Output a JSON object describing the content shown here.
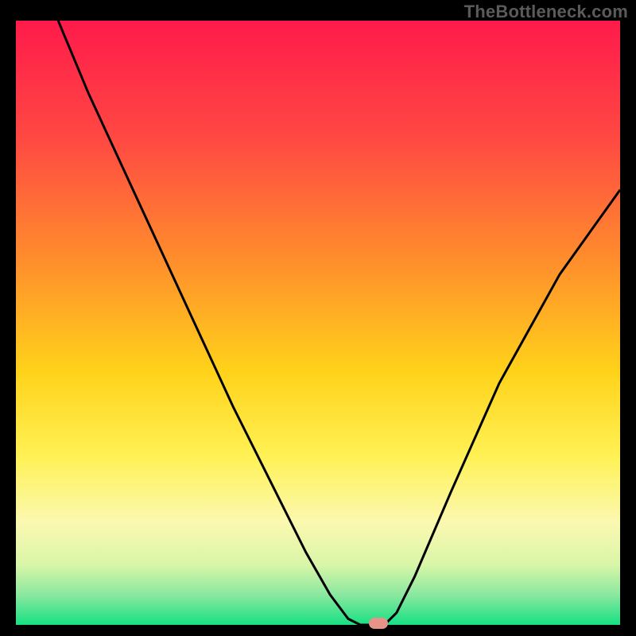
{
  "watermark": "TheBottleneck.com",
  "chart_data": {
    "type": "line",
    "title": "",
    "xlabel": "",
    "ylabel": "",
    "xlim": [
      0,
      100
    ],
    "ylim": [
      0,
      100
    ],
    "grid": false,
    "legend": false,
    "background_gradient": {
      "stops": [
        {
          "pos": 0.0,
          "color": "#ff1a4b"
        },
        {
          "pos": 0.2,
          "color": "#ff4a42"
        },
        {
          "pos": 0.4,
          "color": "#ff8f2c"
        },
        {
          "pos": 0.58,
          "color": "#ffd21a"
        },
        {
          "pos": 0.72,
          "color": "#fff154"
        },
        {
          "pos": 0.83,
          "color": "#fbf8b0"
        },
        {
          "pos": 0.9,
          "color": "#d9f6a8"
        },
        {
          "pos": 0.95,
          "color": "#8be8a0"
        },
        {
          "pos": 1.0,
          "color": "#17e083"
        }
      ]
    },
    "series": [
      {
        "name": "bottleneck-curve",
        "color": "#000000",
        "x": [
          7,
          12,
          18,
          24,
          30,
          36,
          42,
          48,
          52,
          55,
          57,
          58.5,
          60,
          61.5,
          63,
          66,
          72,
          80,
          90,
          100
        ],
        "y": [
          100,
          88,
          75,
          62,
          49,
          36,
          24,
          12,
          5,
          1,
          0,
          0,
          0,
          0.5,
          2,
          8,
          22,
          40,
          58,
          72
        ]
      }
    ],
    "annotations": [
      {
        "name": "min-marker",
        "shape": "pill",
        "x": 60,
        "y": 0,
        "color": "#e8938a"
      }
    ]
  }
}
